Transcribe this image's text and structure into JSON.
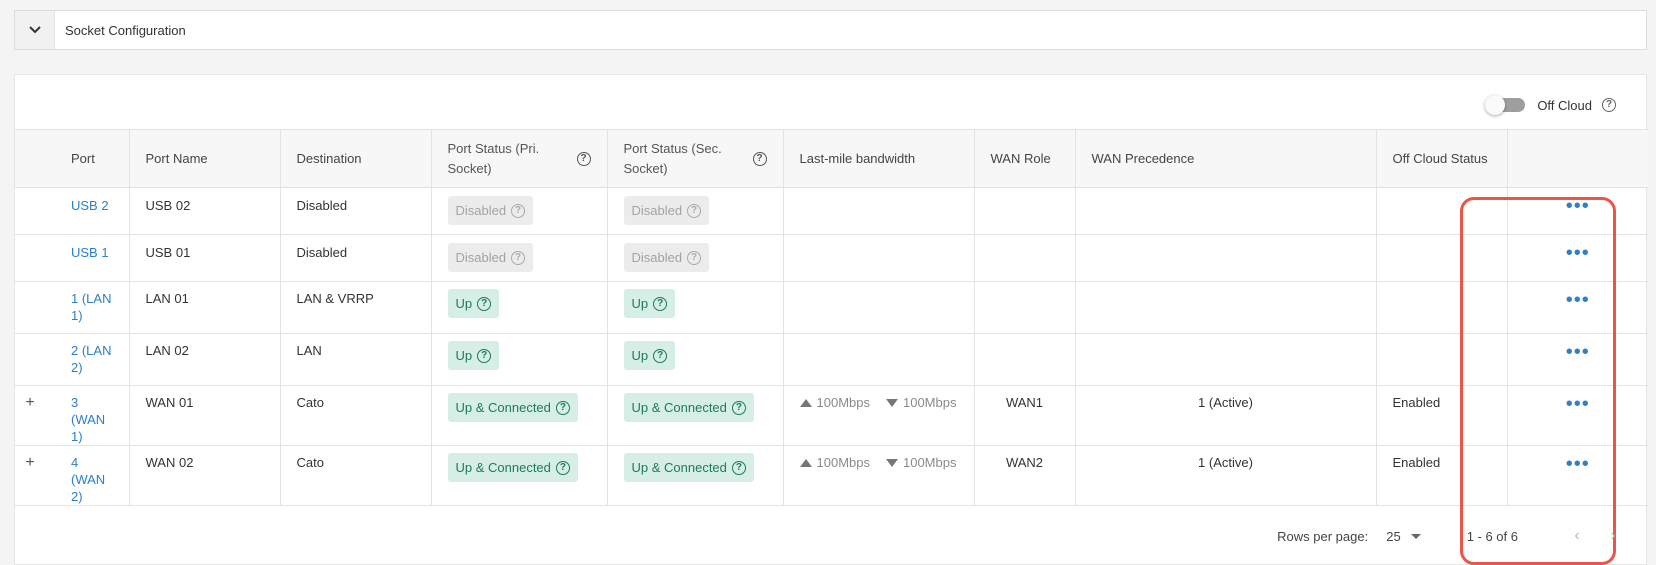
{
  "section": {
    "title": "Socket Configuration",
    "toggle_icon": "chevron-down-icon"
  },
  "toolbar": {
    "off_cloud_label": "Off Cloud",
    "off_cloud_enabled": false
  },
  "table": {
    "headers": {
      "port": "Port",
      "port_name": "Port Name",
      "destination": "Destination",
      "port_status_pri": "Port Status (Pri. Socket)",
      "port_status_sec": "Port Status (Sec. Socket)",
      "bandwidth": "Last-mile bandwidth",
      "wan_role": "WAN Role",
      "wan_precedence": "WAN Precedence",
      "off_cloud_status": "Off Cloud Status"
    },
    "rows": [
      {
        "expand": "",
        "port": "USB 2",
        "port_name": "USB 02",
        "destination": "Disabled",
        "pri": "Disabled",
        "sec": "Disabled",
        "up": "",
        "down": "",
        "wan_role": "",
        "wan_precedence": "",
        "off_cloud_status": ""
      },
      {
        "expand": "",
        "port": "USB 1",
        "port_name": "USB 01",
        "destination": "Disabled",
        "pri": "Disabled",
        "sec": "Disabled",
        "up": "",
        "down": "",
        "wan_role": "",
        "wan_precedence": "",
        "off_cloud_status": ""
      },
      {
        "expand": "",
        "port": "1 (LAN 1)",
        "port_name": "LAN 01",
        "destination": "LAN & VRRP",
        "pri": "Up",
        "sec": "Up",
        "up": "",
        "down": "",
        "wan_role": "",
        "wan_precedence": "",
        "off_cloud_status": ""
      },
      {
        "expand": "",
        "port": "2 (LAN 2)",
        "port_name": "LAN 02",
        "destination": "LAN",
        "pri": "Up",
        "sec": "Up",
        "up": "",
        "down": "",
        "wan_role": "",
        "wan_precedence": "",
        "off_cloud_status": ""
      },
      {
        "expand": "+",
        "port": "3 (WAN 1)",
        "port_name": "WAN 01",
        "destination": "Cato",
        "pri": "Up & Connected",
        "sec": "Up & Connected",
        "up": "100Mbps",
        "down": "100Mbps",
        "wan_role": "WAN1",
        "wan_precedence": "1 (Active)",
        "off_cloud_status": "Enabled"
      },
      {
        "expand": "+",
        "port": "4 (WAN 2)",
        "port_name": "WAN 02",
        "destination": "Cato",
        "pri": "Up & Connected",
        "sec": "Up & Connected",
        "up": "100Mbps",
        "down": "100Mbps",
        "wan_role": "WAN2",
        "wan_precedence": "1 (Active)",
        "off_cloud_status": "Enabled"
      }
    ],
    "row_menu_glyph": "•••"
  },
  "pagination": {
    "rows_per_page_label": "Rows per page:",
    "rows_per_page_value": "25",
    "range": "1 - 6 of 6"
  },
  "colors": {
    "link": "#2b7fcb",
    "status_up_bg": "#d5efe6",
    "status_up_text": "#1f7a55",
    "status_disabled_bg": "#ececec",
    "highlight": "#ec5349"
  }
}
